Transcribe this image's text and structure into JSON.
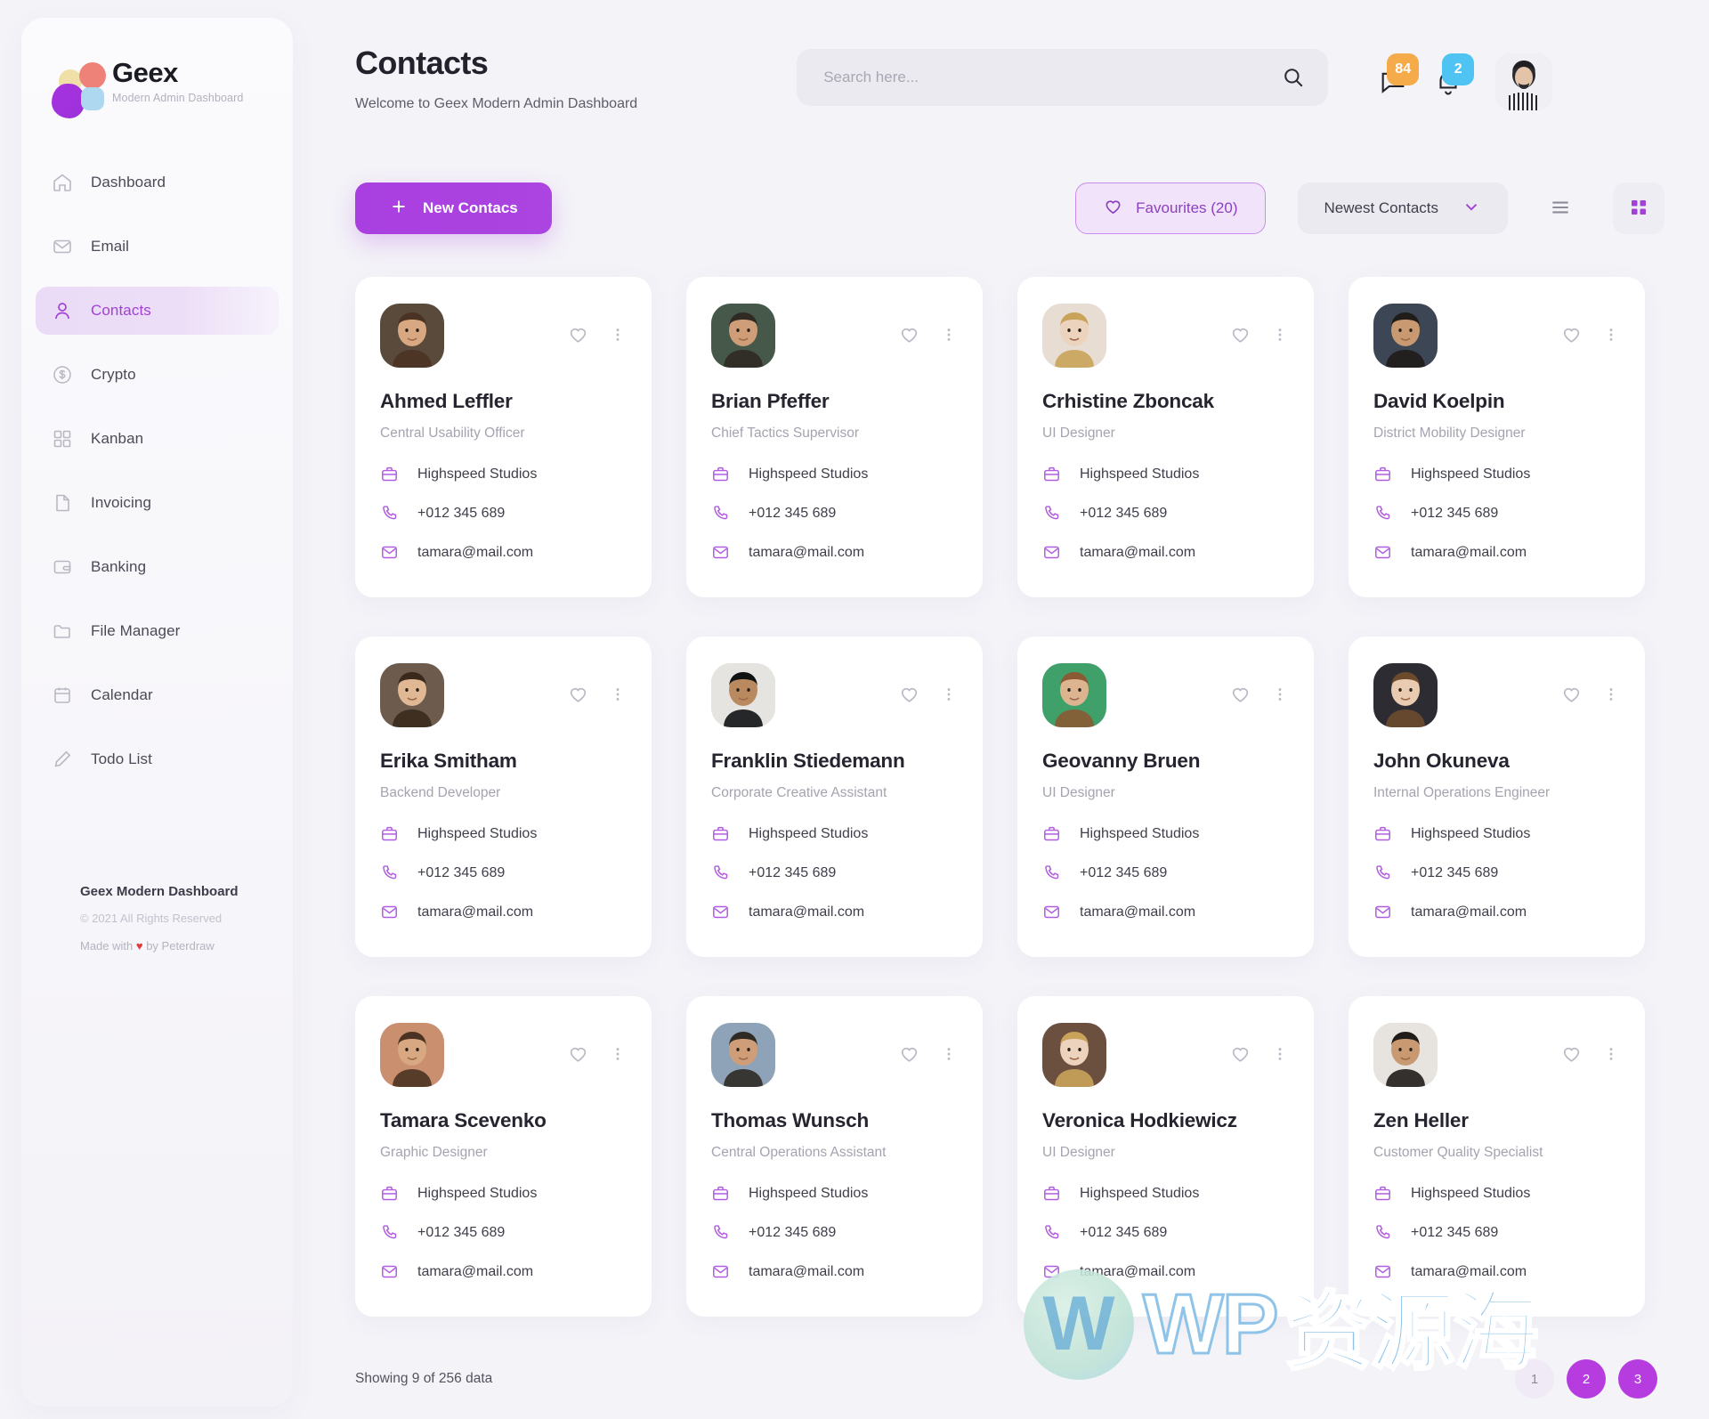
{
  "brand": {
    "name": "Geex",
    "tagline": "Modern Admin Dashboard",
    "logo_colors": {
      "yellow": "#f0dfa6",
      "red": "#ef8278",
      "purple": "#a733e0",
      "blue": "#aed8f0"
    }
  },
  "sidebar": {
    "items": [
      {
        "label": "Dashboard",
        "icon": "home-icon",
        "active": false
      },
      {
        "label": "Email",
        "icon": "envelope-icon",
        "active": false
      },
      {
        "label": "Contacts",
        "icon": "user-icon",
        "active": true
      },
      {
        "label": "Crypto",
        "icon": "dollar-circle-icon",
        "active": false
      },
      {
        "label": "Kanban",
        "icon": "grid-icon",
        "active": false
      },
      {
        "label": "Invoicing",
        "icon": "document-icon",
        "active": false
      },
      {
        "label": "Banking",
        "icon": "wallet-icon",
        "active": false
      },
      {
        "label": "File Manager",
        "icon": "folder-icon",
        "active": false
      },
      {
        "label": "Calendar",
        "icon": "calendar-icon",
        "active": false
      },
      {
        "label": "Todo List",
        "icon": "pencil-icon",
        "active": false
      }
    ],
    "footer": {
      "title": "Geex Modern Dashboard",
      "copyright": "© 2021 All Rights Reserved",
      "made_prefix": "Made with ",
      "made_heart": "♥",
      "made_suffix": " by Peterdraw"
    }
  },
  "header": {
    "title": "Contacts",
    "subtitle": "Welcome to Geex Modern Admin Dashboard",
    "search": {
      "value": "",
      "placeholder": "Search here..."
    },
    "messages_badge": "84",
    "notifications_badge": "2",
    "badge_colors": {
      "messages": "#f5ab4a",
      "notifications": "#4fc3f1"
    }
  },
  "toolbar": {
    "new_contact_label": "New Contacs",
    "favourites_label": "Favourites (20)",
    "sort_label": "Newest Contacts",
    "accent_color": "#a93fe0"
  },
  "contacts": [
    {
      "name": "Ahmed Leffler",
      "role": "Central Usability Officer",
      "company": "Highspeed Studios",
      "phone": "+012 345 689",
      "email": "tamara@mail.com",
      "avatar_bg": "#5a4a3c"
    },
    {
      "name": "Brian Pfeffer",
      "role": "Chief Tactics Supervisor",
      "company": "Highspeed Studios",
      "phone": "+012 345 689",
      "email": "tamara@mail.com",
      "avatar_bg": "#45584a"
    },
    {
      "name": "Crhistine Zboncak",
      "role": "UI Designer",
      "company": "Highspeed Studios",
      "phone": "+012 345 689",
      "email": "tamara@mail.com",
      "avatar_bg": "#e8ddd2"
    },
    {
      "name": "David Koelpin",
      "role": "District Mobility Designer",
      "company": "Highspeed Studios",
      "phone": "+012 345 689",
      "email": "tamara@mail.com",
      "avatar_bg": "#3d4654"
    },
    {
      "name": "Erika Smitham",
      "role": "Backend Developer",
      "company": "Highspeed Studios",
      "phone": "+012 345 689",
      "email": "tamara@mail.com",
      "avatar_bg": "#6d5b4e"
    },
    {
      "name": "Franklin Stiedemann",
      "role": "Corporate Creative Assistant",
      "company": "Highspeed Studios",
      "phone": "+012 345 689",
      "email": "tamara@mail.com",
      "avatar_bg": "#e6e4e0"
    },
    {
      "name": "Geovanny Bruen",
      "role": "UI Designer",
      "company": "Highspeed Studios",
      "phone": "+012 345 689",
      "email": "tamara@mail.com",
      "avatar_bg": "#3fa06a"
    },
    {
      "name": "John Okuneva",
      "role": "Internal Operations Engineer",
      "company": "Highspeed Studios",
      "phone": "+012 345 689",
      "email": "tamara@mail.com",
      "avatar_bg": "#2c2c32"
    },
    {
      "name": "Tamara Scevenko",
      "role": "Graphic Designer",
      "company": "Highspeed Studios",
      "phone": "+012 345 689",
      "email": "tamara@mail.com",
      "avatar_bg": "#c98f6e"
    },
    {
      "name": "Thomas Wunsch",
      "role": "Central Operations Assistant",
      "company": "Highspeed Studios",
      "phone": "+012 345 689",
      "email": "tamara@mail.com",
      "avatar_bg": "#8fa3b8"
    },
    {
      "name": "Veronica Hodkiewicz",
      "role": "UI Designer",
      "company": "Highspeed Studios",
      "phone": "+012 345 689",
      "email": "tamara@mail.com",
      "avatar_bg": "#6b4f3f"
    },
    {
      "name": "Zen Heller",
      "role": "Customer Quality Specialist",
      "company": "Highspeed Studios",
      "phone": "+012 345 689",
      "email": "tamara@mail.com",
      "avatar_bg": "#e7e3de"
    }
  ],
  "footer": {
    "showing": "Showing 9 of 256 data",
    "pages": [
      "1",
      "2",
      "3"
    ]
  },
  "watermark": {
    "logo_letter": "W",
    "wp": "WP",
    "cn": "资源海"
  }
}
